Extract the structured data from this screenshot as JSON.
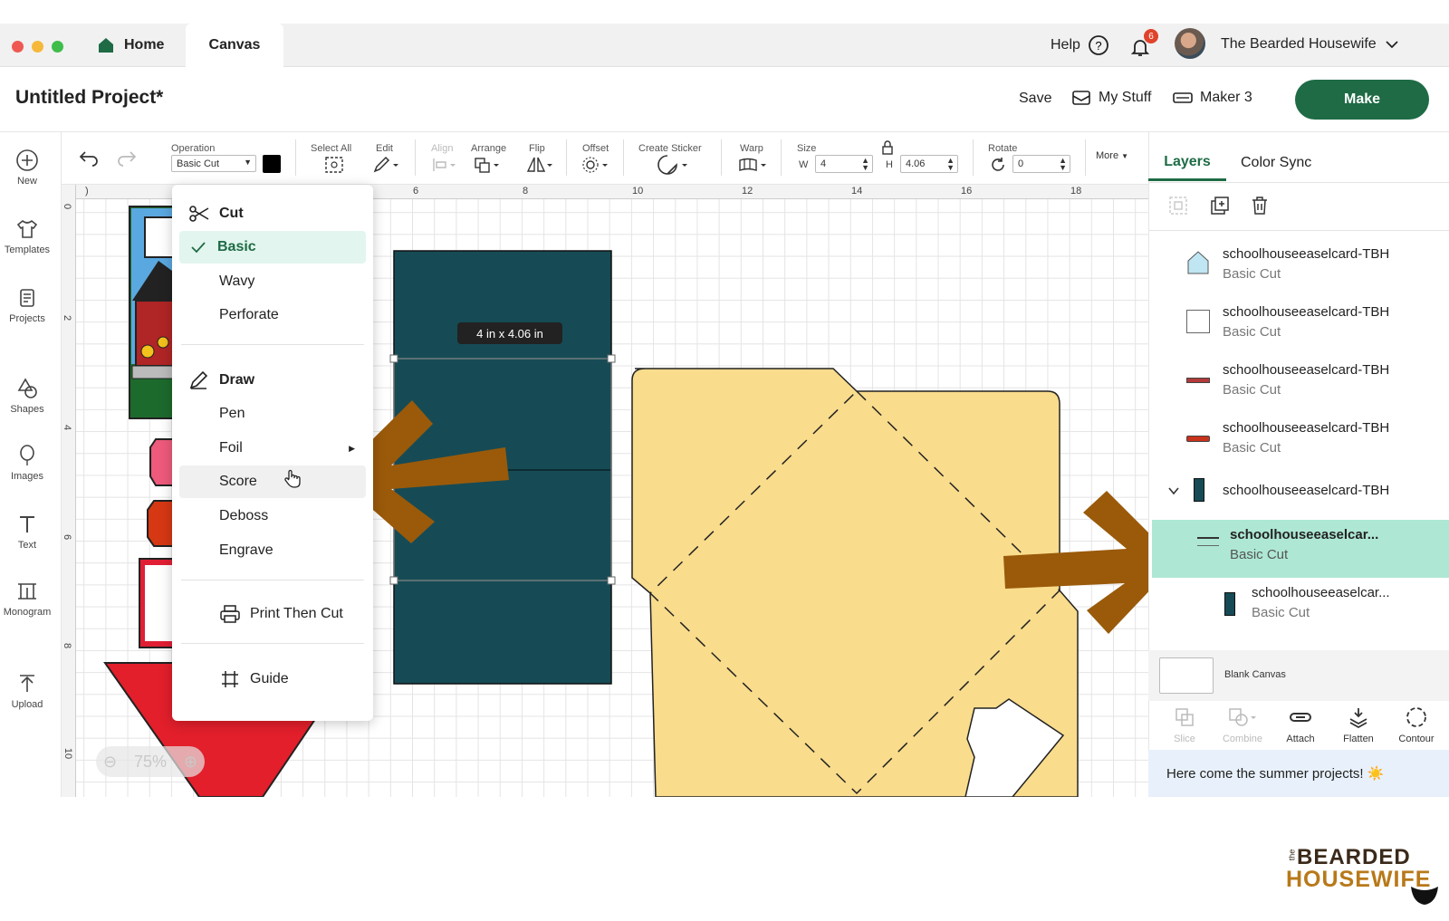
{
  "titlebar": {
    "home_label": "Home",
    "canvas_label": "Canvas",
    "help_label": "Help",
    "notification_count": "6",
    "user_name": "The Bearded Housewife"
  },
  "header": {
    "project_title": "Untitled Project*",
    "save_label": "Save",
    "mystuff_label": "My Stuff",
    "machine_label": "Maker 3",
    "make_label": "Make"
  },
  "leftnav": [
    "New",
    "Templates",
    "Projects",
    "Shapes",
    "Images",
    "Text",
    "Monogram",
    "Upload"
  ],
  "toolbar": {
    "operation_label": "Operation",
    "operation_value": "Basic Cut",
    "selectall_label": "Select All",
    "edit_label": "Edit",
    "align_label": "Align",
    "arrange_label": "Arrange",
    "flip_label": "Flip",
    "offset_label": "Offset",
    "sticker_label": "Create Sticker",
    "warp_label": "Warp",
    "size_label": "Size",
    "w_label": "W",
    "w_value": "4",
    "h_label": "H",
    "h_value": "4.06",
    "rotate_label": "Rotate",
    "rotate_value": "0",
    "more_label": "More"
  },
  "ruler": {
    "top": [
      "6",
      "8",
      "10",
      "12",
      "14",
      "16",
      "18"
    ],
    "left": [
      "0",
      "2",
      "4",
      "6",
      "8",
      "10"
    ]
  },
  "canvas": {
    "size_tooltip": "4  in x 4.06  in",
    "zoom": "75%"
  },
  "operation_menu": {
    "cut": {
      "label": "Cut",
      "items": [
        "Basic",
        "Wavy",
        "Perforate"
      ],
      "selected": "Basic"
    },
    "draw": {
      "label": "Draw",
      "items": [
        "Pen",
        "Foil",
        "Score",
        "Deboss",
        "Engrave"
      ]
    },
    "print": "Print Then Cut",
    "guide": "Guide"
  },
  "panel": {
    "tabs": [
      "Layers",
      "Color Sync"
    ],
    "layers": [
      {
        "name": "schoolhouseeaselcard-TBH",
        "op": "Basic Cut",
        "color": "#bfe6f2"
      },
      {
        "name": "schoolhouseeaselcard-TBH",
        "op": "Basic Cut",
        "color": "#ffffff"
      },
      {
        "name": "schoolhouseeaselcard-TBH",
        "op": "Basic Cut",
        "color": "#b33a3a"
      },
      {
        "name": "schoolhouseeaselcard-TBH",
        "op": "Basic Cut",
        "color": "#c9321b"
      }
    ],
    "group_name": "schoolhouseeaselcard-TBH",
    "children": [
      {
        "name": "schoolhouseeaselcar...",
        "op": "Basic Cut"
      },
      {
        "name": "schoolhouseeaselcar...",
        "op": "Basic Cut"
      }
    ],
    "blank_canvas": "Blank Canvas",
    "tools": [
      "Slice",
      "Combine",
      "Attach",
      "Flatten",
      "Contour"
    ],
    "banner": "Here come the summer projects! ☀️"
  },
  "logo": {
    "line1": "BEARDED",
    "line2": "HOUSEWIFE",
    "small": "the"
  },
  "colors": {
    "accent": "#1e6b45",
    "selected_row": "#aee8d4",
    "teal_shape": "#164b55",
    "yellow_shape": "#f9dc8c",
    "arrow": "#9a5a0a"
  }
}
